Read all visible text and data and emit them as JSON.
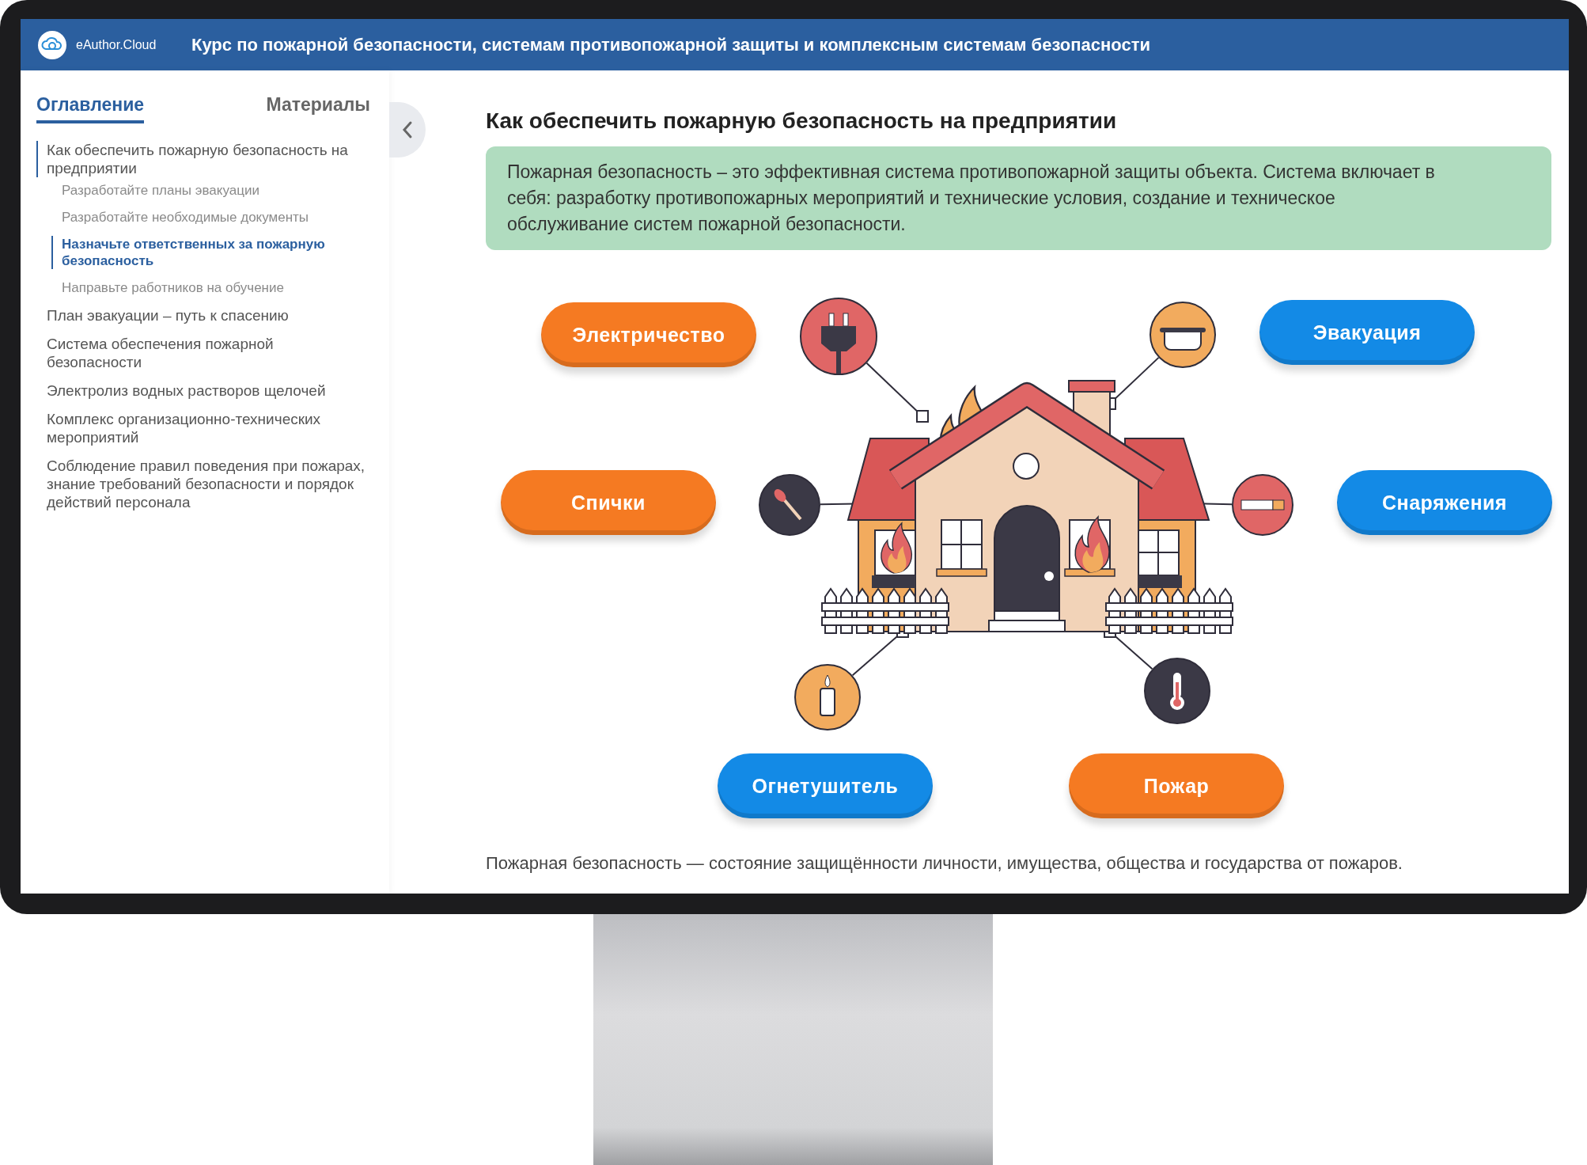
{
  "window": {
    "logo_text": "eAuthor.Cloud",
    "title": "Курс по пожарной безопасности, системам противопожарной защиты и комплексным системам безопасности"
  },
  "sidebar": {
    "tabs": [
      {
        "label": "Оглавление",
        "selected": true
      },
      {
        "label": "Материалы",
        "selected": false
      }
    ],
    "toc": [
      {
        "label": "Как обеспечить пожарную безопасность на предприятии",
        "selected": false,
        "expanded": true,
        "children": [
          {
            "label": "Разработайте планы эвакуации",
            "selected": false
          },
          {
            "label": "Разработайте необходимые документы",
            "selected": false
          },
          {
            "label": "Назначьте ответственных за пожарную безопасность",
            "selected": true
          },
          {
            "label": "Направьте работников на обучение",
            "selected": false
          }
        ]
      },
      {
        "label": "План эвакуации – путь к спасению",
        "selected": false
      },
      {
        "label": "Система обеспечения пожарной безопасности",
        "selected": false
      },
      {
        "label": "Электролиз водных растворов щелочей",
        "selected": false
      },
      {
        "label": "Комплекс организационно-технических мероприятий",
        "selected": false
      },
      {
        "label": "Соблюдение правил поведения при пожарах, знание требований безопасности и порядок действий персонала",
        "selected": false
      }
    ]
  },
  "content": {
    "heading": "Как обеспечить пожарную безопасность на предприятии",
    "callout": "Пожарная безопасность – это эффективная система противопожарной защиты объекта. Система включает в себя: разработку противопожарных мероприятий и технические условия, создание и техническое обслуживание систем пожарной безопасности.",
    "diagram_buttons": [
      {
        "label": "Электричество",
        "color": "#f57a22"
      },
      {
        "label": "Эвакуация",
        "color": "#138ae6"
      },
      {
        "label": "Спички",
        "color": "#f57a22"
      },
      {
        "label": "Снаряжения",
        "color": "#138ae6"
      },
      {
        "label": "Огнетушитель",
        "color": "#138ae6"
      },
      {
        "label": "Пожар",
        "color": "#f57a22"
      }
    ],
    "footer_text": "Пожарная безопасность — состояние защищённости личности, имущества, общества и государства от пожаров."
  }
}
